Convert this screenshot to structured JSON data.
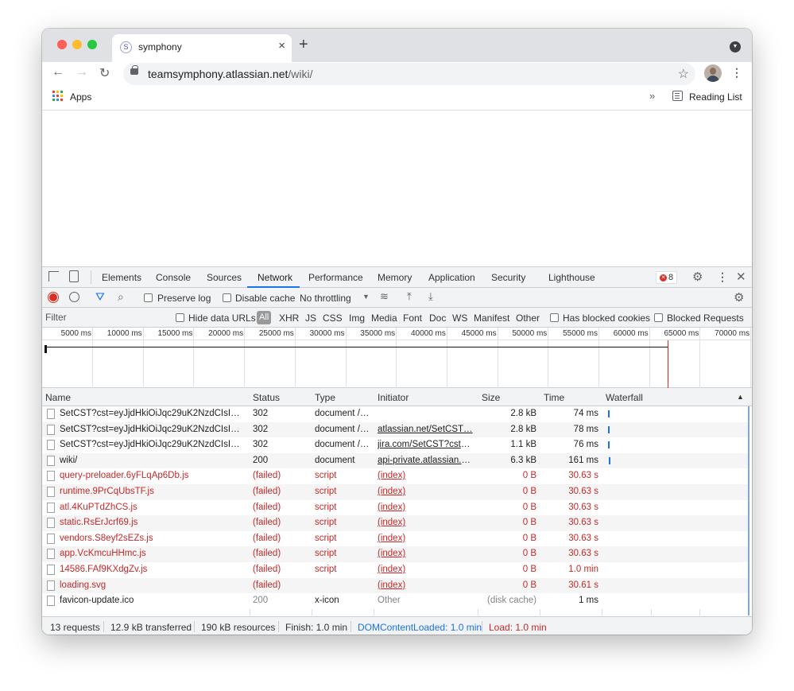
{
  "browser": {
    "tab_title": "symphony",
    "tab_favicon": "S",
    "new_tab": "+",
    "close_tab": "×",
    "url_domain": "teamsymphony.atlassian.net",
    "url_path": "/wiki/",
    "bookmarks": {
      "apps_label": "Apps",
      "overflow": "»",
      "reading_list_label": "Reading List"
    }
  },
  "devtools": {
    "tabs": [
      "Elements",
      "Console",
      "Sources",
      "Network",
      "Performance",
      "Memory",
      "Application",
      "Security",
      "Lighthouse"
    ],
    "active_tab": "Network",
    "error_count": "8",
    "controls": {
      "preserve_log": "Preserve log",
      "disable_cache": "Disable cache",
      "throttling": "No throttling"
    },
    "filter": {
      "placeholder": "Filter",
      "hide_data_urls": "Hide data URLs",
      "types": [
        "All",
        "XHR",
        "JS",
        "CSS",
        "Img",
        "Media",
        "Font",
        "Doc",
        "WS",
        "Manifest",
        "Other"
      ],
      "has_blocked_cookies": "Has blocked cookies",
      "blocked_requests": "Blocked Requests"
    },
    "timeline_ticks": [
      "5000 ms",
      "10000 ms",
      "15000 ms",
      "20000 ms",
      "25000 ms",
      "30000 ms",
      "35000 ms",
      "40000 ms",
      "45000 ms",
      "50000 ms",
      "55000 ms",
      "60000 ms",
      "65000 ms",
      "70000 ms"
    ],
    "columns": [
      "Name",
      "Status",
      "Type",
      "Initiator",
      "Size",
      "Time",
      "Waterfall"
    ],
    "sort_indicator": "▲",
    "requests": [
      {
        "name": "SetCST?cst=eyJjdHkiOiJqc29uK2NzdCIsIm…",
        "status": "302",
        "type": "document /…",
        "initiator": "",
        "size": "2.8 kB",
        "time": "74 ms",
        "failed": false
      },
      {
        "name": "SetCST?cst=eyJjdHkiOiJqc29uK2NzdCIsIm…",
        "status": "302",
        "type": "document /…",
        "initiator": "atlassian.net/SetCST…",
        "size": "2.8 kB",
        "time": "78 ms",
        "failed": false
      },
      {
        "name": "SetCST?cst=eyJjdHkiOiJqc29uK2NzdCIsIm…",
        "status": "302",
        "type": "document /…",
        "initiator": "jira.com/SetCST?cst=…",
        "size": "1.1 kB",
        "time": "76 ms",
        "failed": false
      },
      {
        "name": "wiki/",
        "status": "200",
        "type": "document",
        "initiator": "api-private.atlassian.c…",
        "size": "6.3 kB",
        "time": "161 ms",
        "failed": false
      },
      {
        "name": "query-preloader.6yFLqAp6Db.js",
        "status": "(failed)",
        "type": "script",
        "initiator": "(index)",
        "size": "0 B",
        "time": "30.63 s",
        "failed": true
      },
      {
        "name": "runtime.9PrCqUbsTF.js",
        "status": "(failed)",
        "type": "script",
        "initiator": "(index)",
        "size": "0 B",
        "time": "30.63 s",
        "failed": true
      },
      {
        "name": "atl.4KuPTdZhCS.js",
        "status": "(failed)",
        "type": "script",
        "initiator": "(index)",
        "size": "0 B",
        "time": "30.63 s",
        "failed": true
      },
      {
        "name": "static.RsErJcrf69.js",
        "status": "(failed)",
        "type": "script",
        "initiator": "(index)",
        "size": "0 B",
        "time": "30.63 s",
        "failed": true
      },
      {
        "name": "vendors.S8eyf2sEZs.js",
        "status": "(failed)",
        "type": "script",
        "initiator": "(index)",
        "size": "0 B",
        "time": "30.63 s",
        "failed": true
      },
      {
        "name": "app.VcKmcuHHmc.js",
        "status": "(failed)",
        "type": "script",
        "initiator": "(index)",
        "size": "0 B",
        "time": "30.63 s",
        "failed": true
      },
      {
        "name": "14586.FAf9KXdgZv.js",
        "status": "(failed)",
        "type": "script",
        "initiator": "(index)",
        "size": "0 B",
        "time": "1.0 min",
        "failed": true
      },
      {
        "name": "loading.svg",
        "status": "(failed)",
        "type": "",
        "initiator": "(index)",
        "size": "0 B",
        "time": "30.61 s",
        "failed": true
      },
      {
        "name": "favicon-update.ico",
        "status": "200",
        "type": "x-icon",
        "initiator": "Other",
        "size": "(disk cache)",
        "time": "1 ms",
        "failed": false
      }
    ],
    "status_bar": {
      "requests": "13 requests",
      "transferred": "12.9 kB transferred",
      "resources": "190 kB resources",
      "finish": "Finish: 1.0 min",
      "dom_content_loaded": "DOMContentLoaded: 1.0 min",
      "load": "Load: 1.0 min"
    }
  },
  "colors": {
    "accent": "#1a73e8",
    "failed": "#c62828",
    "record": "#d93025"
  }
}
